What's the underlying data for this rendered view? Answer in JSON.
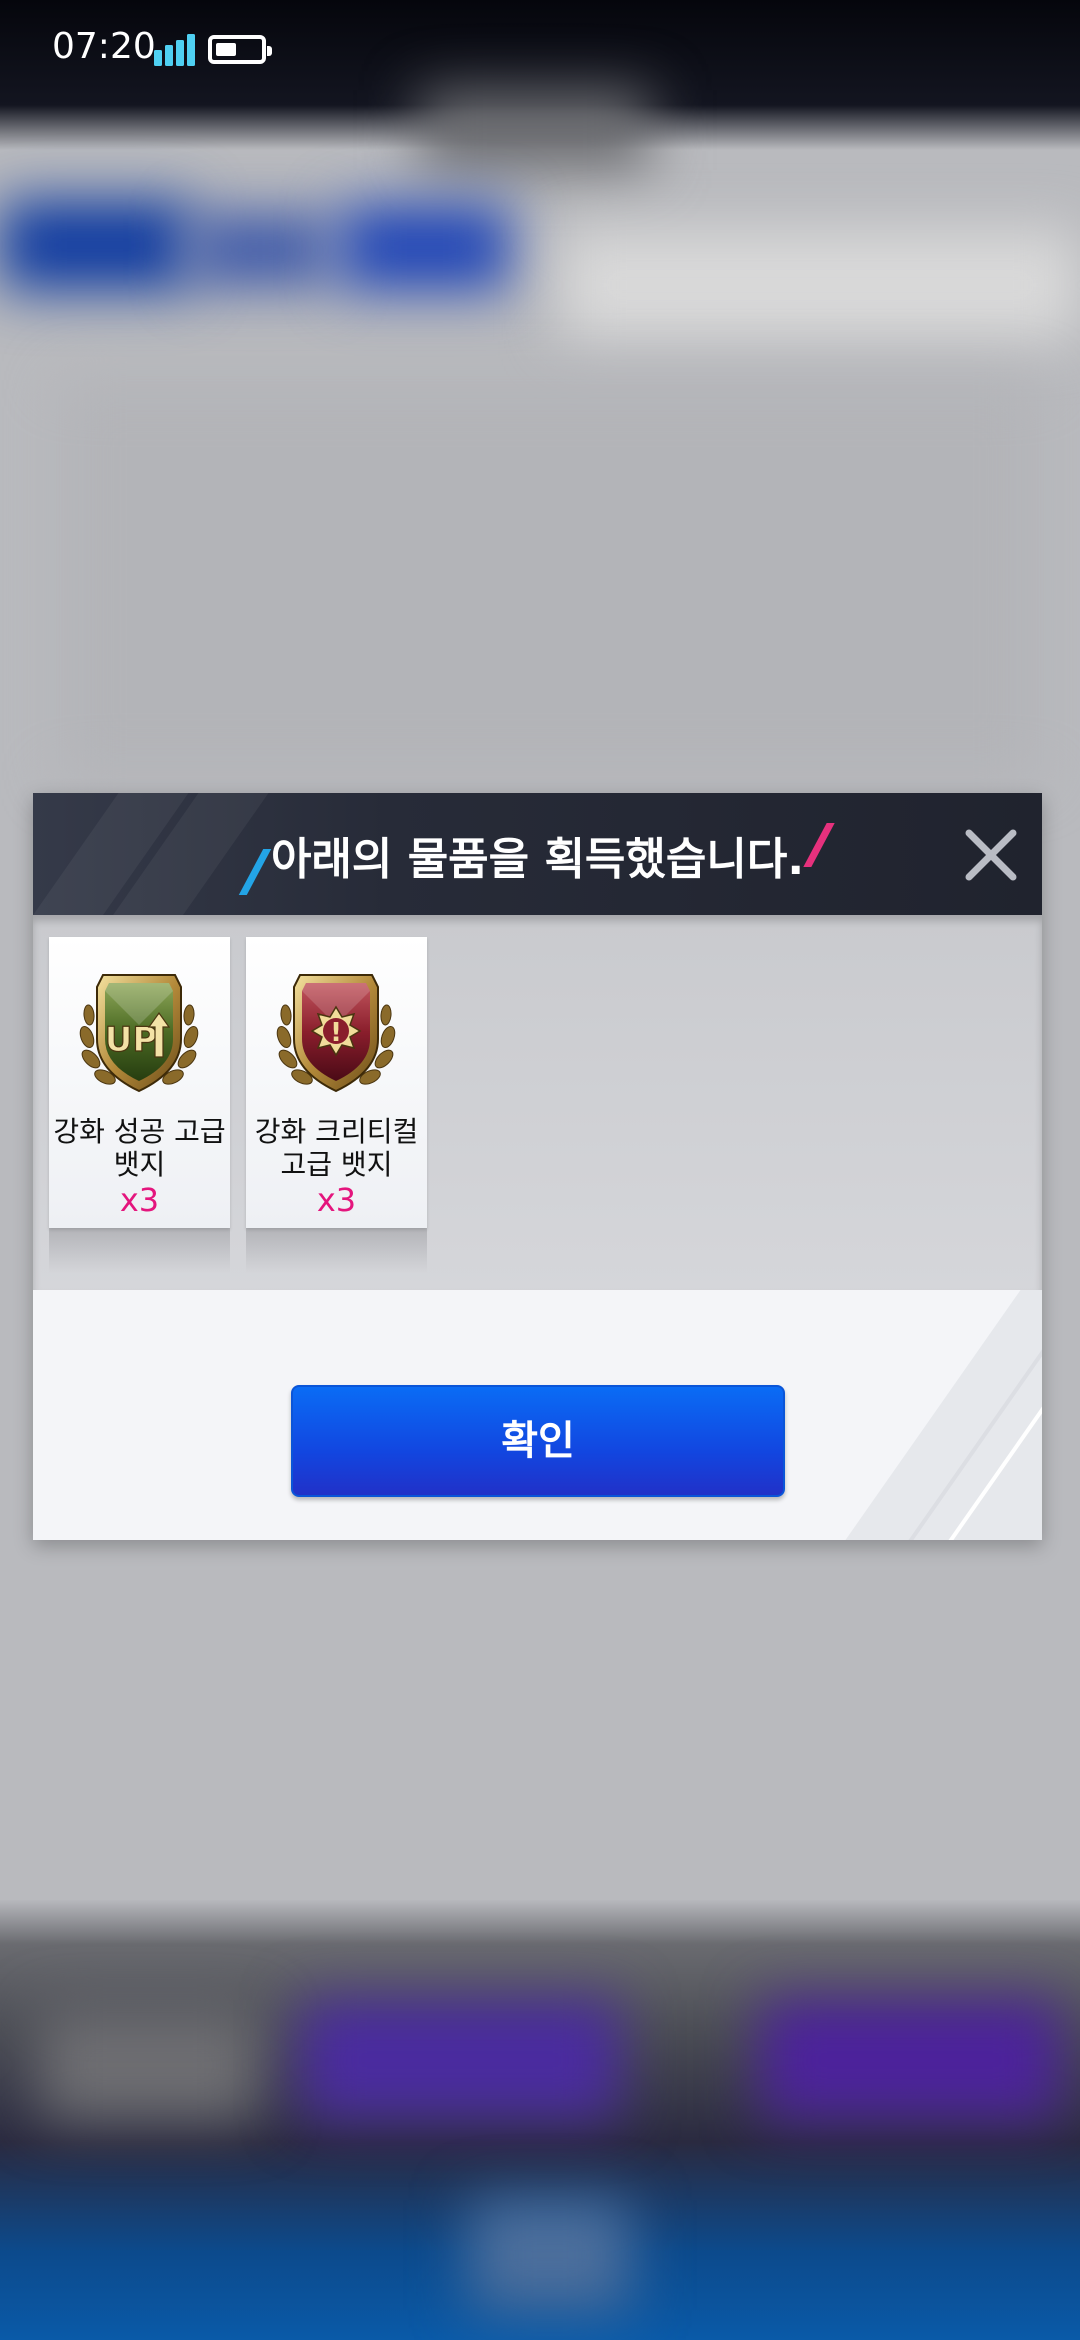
{
  "status_bar": {
    "time": "07:20",
    "signal_icon": "signal-bars-icon",
    "battery_icon": "battery-icon"
  },
  "dialog": {
    "title": "아래의 물품을 획득했습니다.",
    "close_icon": "close-icon",
    "items": [
      {
        "name_line1": "강화 성공 고급",
        "name_line2": "뱃지",
        "quantity": "x3",
        "icon": "upgrade-success-badge-icon",
        "badge_text": "UP"
      },
      {
        "name_line1": "강화 크리티컬",
        "name_line2": "고급 뱃지",
        "quantity": "x3",
        "icon": "upgrade-critical-badge-icon",
        "badge_text": "!"
      }
    ],
    "confirm_label": "확인"
  },
  "colors": {
    "header_bg": "#272b38",
    "quantity": "#e4157d",
    "confirm_button": "#1246e0",
    "slash_blue": "#23a4e6",
    "slash_pink": "#e6317d"
  }
}
